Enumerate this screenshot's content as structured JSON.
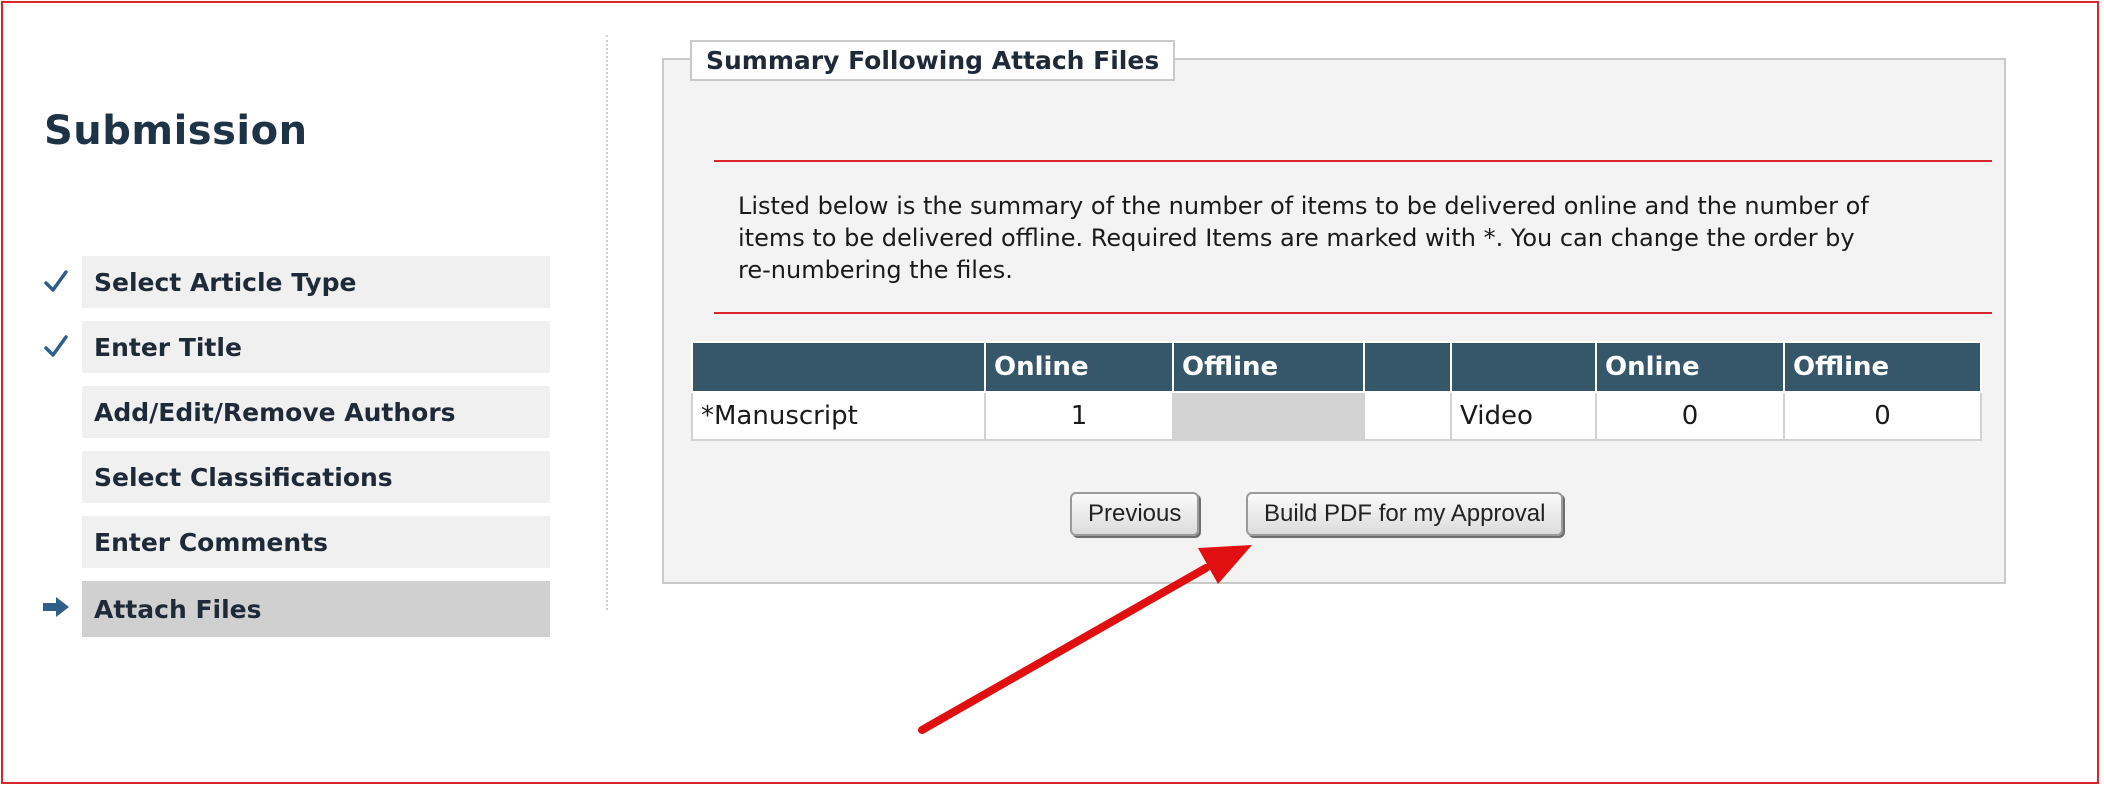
{
  "page": {
    "title": "Submission"
  },
  "steps": [
    {
      "label": "Select Article Type",
      "status": "done"
    },
    {
      "label": "Enter Title",
      "status": "done"
    },
    {
      "label": "Add/Edit/Remove Authors",
      "status": "pending"
    },
    {
      "label": "Select Classifications",
      "status": "pending"
    },
    {
      "label": "Enter Comments",
      "status": "pending"
    },
    {
      "label": "Attach Files",
      "status": "current"
    }
  ],
  "step_icons": {
    "done": "checkmark-icon",
    "current": "arrow-right-icon"
  },
  "summary": {
    "title": "Summary Following Attach Files",
    "instructions": "Listed below is the summary of the number of items to be delivered online and the number of items to be delivered offline. Required Items are marked with *. You can change the order by re-numbering the files.",
    "table": {
      "headers": [
        "",
        "Online",
        "Offline",
        "",
        "",
        "Online",
        "Offline"
      ],
      "rows": [
        [
          "*Manuscript",
          "1",
          "",
          "",
          "Video",
          "0",
          "0"
        ]
      ]
    }
  },
  "buttons": {
    "previous": "Previous",
    "build_pdf": "Build PDF for my Approval"
  },
  "colors": {
    "accent_red": "#d9262b",
    "table_header": "#36566a",
    "title": "#1f3347",
    "icon_blue": "#2f5f8a"
  }
}
